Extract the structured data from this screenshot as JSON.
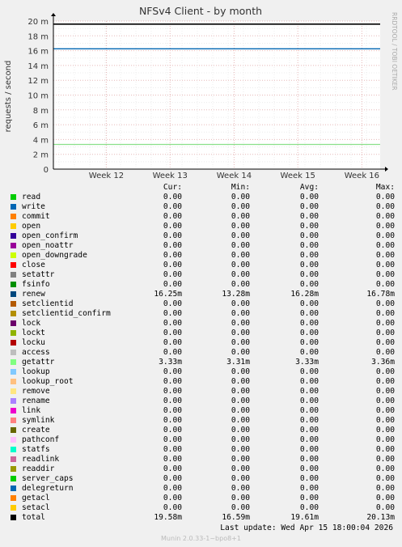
{
  "chart_data": {
    "type": "line",
    "title": "NFSv4 Client - by month",
    "ylabel": "requests / second",
    "watermark": "RRDTOOL / TOBI OETIKER",
    "ylim": [
      0,
      20
    ],
    "y_ticks": [
      "0",
      "2 m",
      "4 m",
      "6 m",
      "8 m",
      "10 m",
      "12 m",
      "14 m",
      "16 m",
      "18 m",
      "20 m"
    ],
    "x_ticks": [
      "Week 12",
      "Week 13",
      "Week 14",
      "Week 15",
      "Week 16"
    ],
    "x_tick_positions": [
      0.162,
      0.357,
      0.553,
      0.748,
      0.944
    ],
    "series": [
      {
        "name": "total",
        "color": "#000000",
        "value": 19.58
      },
      {
        "name": "renew",
        "color": "#0066b3",
        "value": 16.25
      },
      {
        "name": "getattr",
        "color": "#8be08b",
        "value": 3.33
      }
    ],
    "grid": true
  },
  "legend": {
    "headers": {
      "cur": "Cur:",
      "min": "Min:",
      "avg": "Avg:",
      "max": "Max:"
    },
    "rows": [
      {
        "name": "read",
        "color": "#00cc00",
        "cur": "0.00",
        "min": "0.00",
        "avg": "0.00",
        "max": "0.00"
      },
      {
        "name": "write",
        "color": "#0066b3",
        "cur": "0.00",
        "min": "0.00",
        "avg": "0.00",
        "max": "0.00"
      },
      {
        "name": "commit",
        "color": "#ff8000",
        "cur": "0.00",
        "min": "0.00",
        "avg": "0.00",
        "max": "0.00"
      },
      {
        "name": "open",
        "color": "#ffcc00",
        "cur": "0.00",
        "min": "0.00",
        "avg": "0.00",
        "max": "0.00"
      },
      {
        "name": "open_confirm",
        "color": "#330099",
        "cur": "0.00",
        "min": "0.00",
        "avg": "0.00",
        "max": "0.00"
      },
      {
        "name": "open_noattr",
        "color": "#990099",
        "cur": "0.00",
        "min": "0.00",
        "avg": "0.00",
        "max": "0.00"
      },
      {
        "name": "open_downgrade",
        "color": "#ccff00",
        "cur": "0.00",
        "min": "0.00",
        "avg": "0.00",
        "max": "0.00"
      },
      {
        "name": "close",
        "color": "#ff0000",
        "cur": "0.00",
        "min": "0.00",
        "avg": "0.00",
        "max": "0.00"
      },
      {
        "name": "setattr",
        "color": "#808080",
        "cur": "0.00",
        "min": "0.00",
        "avg": "0.00",
        "max": "0.00"
      },
      {
        "name": "fsinfo",
        "color": "#008f00",
        "cur": "0.00",
        "min": "0.00",
        "avg": "0.00",
        "max": "0.00"
      },
      {
        "name": "renew",
        "color": "#00487d",
        "cur": "16.25m",
        "min": "13.28m",
        "avg": "16.28m",
        "max": "16.78m"
      },
      {
        "name": "setclientid",
        "color": "#b35a00",
        "cur": "0.00",
        "min": "0.00",
        "avg": "0.00",
        "max": "0.00"
      },
      {
        "name": "setclientid_confirm",
        "color": "#b38f00",
        "cur": "0.00",
        "min": "0.00",
        "avg": "0.00",
        "max": "0.00"
      },
      {
        "name": "lock",
        "color": "#6b006b",
        "cur": "0.00",
        "min": "0.00",
        "avg": "0.00",
        "max": "0.00"
      },
      {
        "name": "lockt",
        "color": "#8fb300",
        "cur": "0.00",
        "min": "0.00",
        "avg": "0.00",
        "max": "0.00"
      },
      {
        "name": "locku",
        "color": "#b30000",
        "cur": "0.00",
        "min": "0.00",
        "avg": "0.00",
        "max": "0.00"
      },
      {
        "name": "access",
        "color": "#bebebe",
        "cur": "0.00",
        "min": "0.00",
        "avg": "0.00",
        "max": "0.00"
      },
      {
        "name": "getattr",
        "color": "#80ff80",
        "cur": "3.33m",
        "min": "3.31m",
        "avg": "3.33m",
        "max": "3.36m"
      },
      {
        "name": "lookup",
        "color": "#80c9ff",
        "cur": "0.00",
        "min": "0.00",
        "avg": "0.00",
        "max": "0.00"
      },
      {
        "name": "lookup_root",
        "color": "#ffc080",
        "cur": "0.00",
        "min": "0.00",
        "avg": "0.00",
        "max": "0.00"
      },
      {
        "name": "remove",
        "color": "#ffe680",
        "cur": "0.00",
        "min": "0.00",
        "avg": "0.00",
        "max": "0.00"
      },
      {
        "name": "rename",
        "color": "#aa80ff",
        "cur": "0.00",
        "min": "0.00",
        "avg": "0.00",
        "max": "0.00"
      },
      {
        "name": "link",
        "color": "#ee00cc",
        "cur": "0.00",
        "min": "0.00",
        "avg": "0.00",
        "max": "0.00"
      },
      {
        "name": "symlink",
        "color": "#ff8080",
        "cur": "0.00",
        "min": "0.00",
        "avg": "0.00",
        "max": "0.00"
      },
      {
        "name": "create",
        "color": "#666600",
        "cur": "0.00",
        "min": "0.00",
        "avg": "0.00",
        "max": "0.00"
      },
      {
        "name": "pathconf",
        "color": "#ffbfff",
        "cur": "0.00",
        "min": "0.00",
        "avg": "0.00",
        "max": "0.00"
      },
      {
        "name": "statfs",
        "color": "#00ffcc",
        "cur": "0.00",
        "min": "0.00",
        "avg": "0.00",
        "max": "0.00"
      },
      {
        "name": "readlink",
        "color": "#cc6699",
        "cur": "0.00",
        "min": "0.00",
        "avg": "0.00",
        "max": "0.00"
      },
      {
        "name": "readdir",
        "color": "#999900",
        "cur": "0.00",
        "min": "0.00",
        "avg": "0.00",
        "max": "0.00"
      },
      {
        "name": "server_caps",
        "color": "#00cc00",
        "cur": "0.00",
        "min": "0.00",
        "avg": "0.00",
        "max": "0.00"
      },
      {
        "name": "delegreturn",
        "color": "#0066b3",
        "cur": "0.00",
        "min": "0.00",
        "avg": "0.00",
        "max": "0.00"
      },
      {
        "name": "getacl",
        "color": "#ff8000",
        "cur": "0.00",
        "min": "0.00",
        "avg": "0.00",
        "max": "0.00"
      },
      {
        "name": "setacl",
        "color": "#ffcc00",
        "cur": "0.00",
        "min": "0.00",
        "avg": "0.00",
        "max": "0.00"
      },
      {
        "name": "total",
        "color": "#000000",
        "cur": "19.58m",
        "min": "16.59m",
        "avg": "19.61m",
        "max": "20.13m"
      }
    ]
  },
  "footer": {
    "last_update": "Last update:  Wed Apr 15 18:00:04 2026",
    "munin": "Munin 2.0.33-1~bpo8+1"
  }
}
